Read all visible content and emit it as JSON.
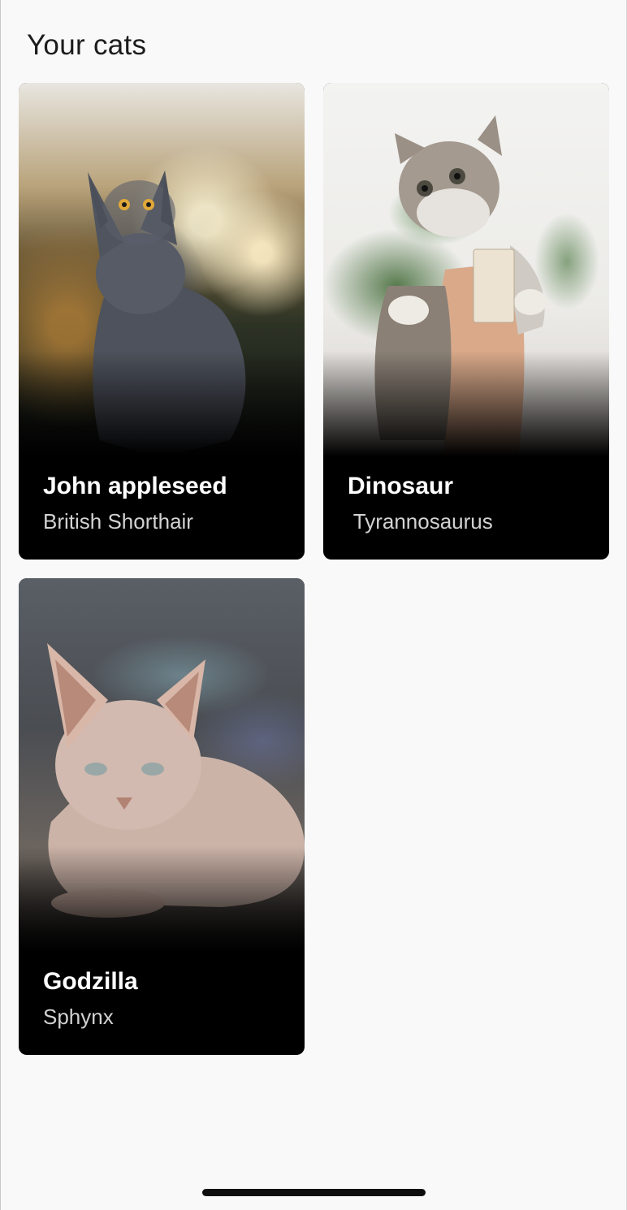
{
  "header": {
    "title": "Your cats"
  },
  "cats": [
    {
      "name": "John appleseed",
      "breed": "British Shorthair",
      "photo_icon": "gray-british-shorthair-photo"
    },
    {
      "name": "Dinosaur",
      "breed": " Tyrannosaurus",
      "photo_icon": "tabby-kitten-photo"
    },
    {
      "name": "Godzilla",
      "breed": "Sphynx",
      "photo_icon": "sphynx-cat-photo"
    }
  ],
  "colors": {
    "background": "#f9f9f9",
    "card": "#000000",
    "name_text": "#ffffff",
    "breed_text": "#d2d2d2"
  }
}
